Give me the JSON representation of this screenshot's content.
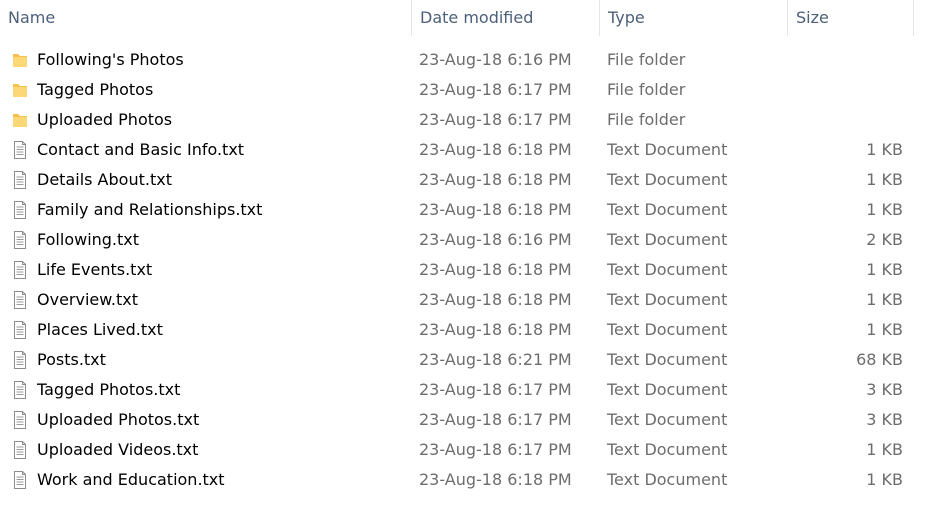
{
  "header": {
    "columns": {
      "name": "Name",
      "date": "Date modified",
      "type": "Type",
      "size": "Size"
    },
    "sort_icon": "sort-ascending-icon"
  },
  "files": [
    {
      "name": "Following's Photos",
      "date": "23-Aug-18 6:16 PM",
      "type": "File folder",
      "size": "",
      "icon": "folder-icon"
    },
    {
      "name": "Tagged Photos",
      "date": "23-Aug-18 6:17 PM",
      "type": "File folder",
      "size": "",
      "icon": "folder-icon"
    },
    {
      "name": "Uploaded Photos",
      "date": "23-Aug-18 6:17 PM",
      "type": "File folder",
      "size": "",
      "icon": "folder-icon"
    },
    {
      "name": "Contact and Basic Info.txt",
      "date": "23-Aug-18 6:18 PM",
      "type": "Text Document",
      "size": "1 KB",
      "icon": "text-document-icon"
    },
    {
      "name": "Details About.txt",
      "date": "23-Aug-18 6:18 PM",
      "type": "Text Document",
      "size": "1 KB",
      "icon": "text-document-icon"
    },
    {
      "name": "Family and Relationships.txt",
      "date": "23-Aug-18 6:18 PM",
      "type": "Text Document",
      "size": "1 KB",
      "icon": "text-document-icon"
    },
    {
      "name": "Following.txt",
      "date": "23-Aug-18 6:16 PM",
      "type": "Text Document",
      "size": "2 KB",
      "icon": "text-document-icon"
    },
    {
      "name": "Life Events.txt",
      "date": "23-Aug-18 6:18 PM",
      "type": "Text Document",
      "size": "1 KB",
      "icon": "text-document-icon"
    },
    {
      "name": "Overview.txt",
      "date": "23-Aug-18 6:18 PM",
      "type": "Text Document",
      "size": "1 KB",
      "icon": "text-document-icon"
    },
    {
      "name": "Places Lived.txt",
      "date": "23-Aug-18 6:18 PM",
      "type": "Text Document",
      "size": "1 KB",
      "icon": "text-document-icon"
    },
    {
      "name": "Posts.txt",
      "date": "23-Aug-18 6:21 PM",
      "type": "Text Document",
      "size": "68 KB",
      "icon": "text-document-icon"
    },
    {
      "name": "Tagged Photos.txt",
      "date": "23-Aug-18 6:17 PM",
      "type": "Text Document",
      "size": "3 KB",
      "icon": "text-document-icon"
    },
    {
      "name": "Uploaded Photos.txt",
      "date": "23-Aug-18 6:17 PM",
      "type": "Text Document",
      "size": "3 KB",
      "icon": "text-document-icon"
    },
    {
      "name": "Uploaded Videos.txt",
      "date": "23-Aug-18 6:17 PM",
      "type": "Text Document",
      "size": "1 KB",
      "icon": "text-document-icon"
    },
    {
      "name": "Work and Education.txt",
      "date": "23-Aug-18 6:18 PM",
      "type": "Text Document",
      "size": "1 KB",
      "icon": "text-document-icon"
    }
  ],
  "colors": {
    "header_text": "#4c607a",
    "secondary_text": "#6d6d6d",
    "folder": "#f5c14b"
  }
}
